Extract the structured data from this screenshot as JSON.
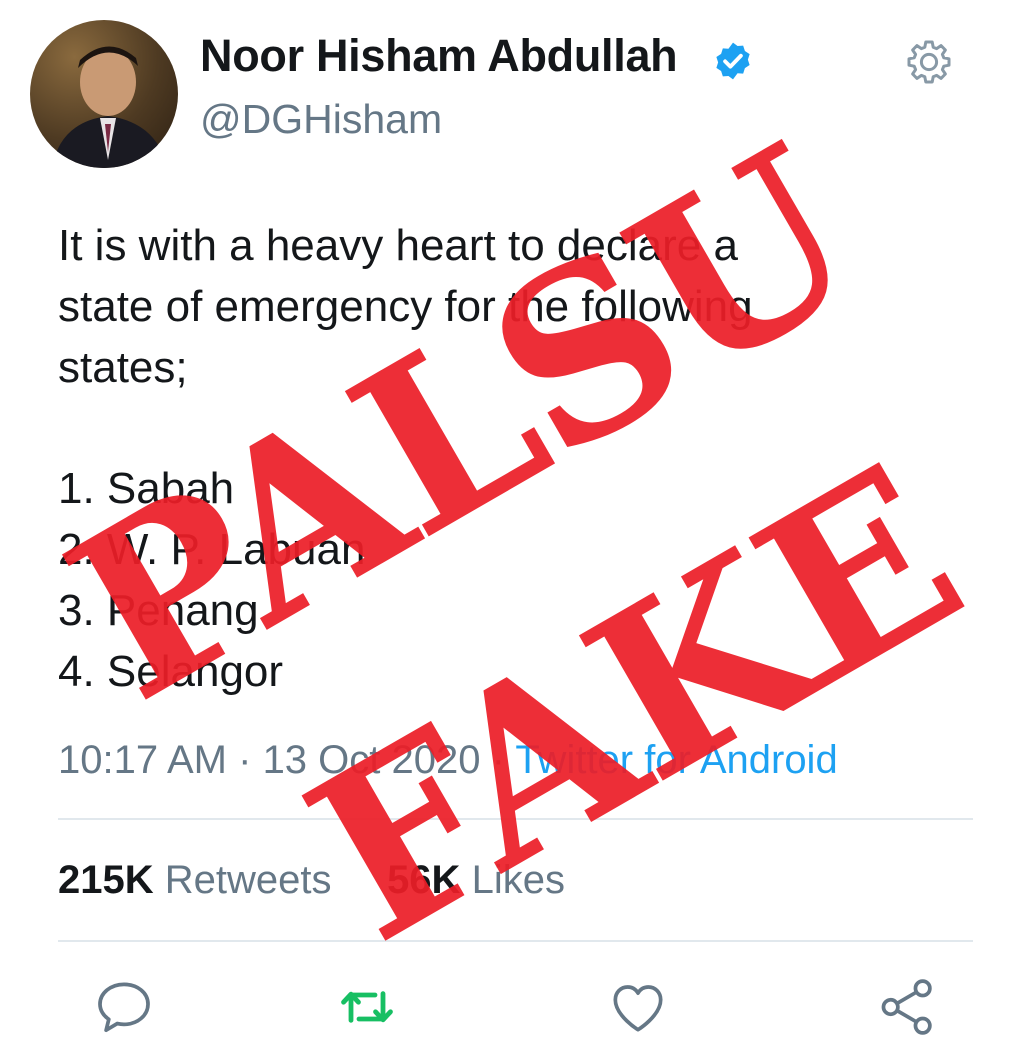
{
  "profile": {
    "display_name": "Noor Hisham Abdullah",
    "handle": "@DGHisham",
    "verified": true
  },
  "tweet": {
    "body_lines": [
      "It is with a heavy heart to declare a",
      "state of emergency for the following",
      "states;"
    ],
    "list_items": [
      "1. Sabah",
      "2. W. P. Labuan",
      "3. Penang",
      "4. Selangor"
    ],
    "time": "10:17 AM",
    "separator": " · ",
    "date": "13 Oct 2020",
    "source": "Twitter for Android"
  },
  "stats": {
    "retweets_count": "215K",
    "retweets_label": " Retweets",
    "likes_count": "56K",
    "likes_label": " Likes"
  },
  "stamps": {
    "palsu": "PALSU",
    "fake": "FAKE"
  },
  "icons": {
    "verified": "verified-badge-icon",
    "settings": "gear-icon",
    "reply": "reply-icon",
    "retweet": "retweet-icon",
    "like": "heart-icon",
    "share": "share-icon"
  },
  "colors": {
    "verified_blue": "#1da1f2",
    "retweet_green": "#17bf63",
    "muted_text": "#657786",
    "stamp_red": "#ec1e28"
  }
}
